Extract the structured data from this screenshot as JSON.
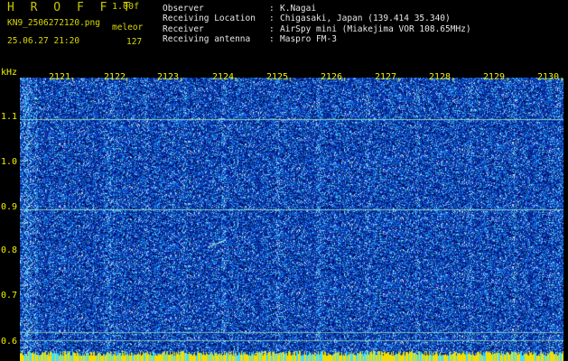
{
  "header": {
    "logo": "H R O F F T",
    "version": "1.00f",
    "filename": "KN9_2506272120.png",
    "program": "meleor",
    "datetime": "25.06.27 21:20",
    "count": "127",
    "fields": [
      {
        "label": "Observer",
        "value": "K.Nagai"
      },
      {
        "label": "Receiving Location",
        "value": "Chigasaki, Japan (139.414 35.340)"
      },
      {
        "label": "Receiver",
        "value": "AirSpy mini (Miakejima VOR 108.65MHz)"
      },
      {
        "label": "Receiving antenna",
        "value": "Maspro FM-3"
      }
    ]
  },
  "axes": {
    "y_unit": "kHz",
    "y_ticks": [
      "1.1",
      "1.0",
      "0.9",
      "0.8",
      "0.7",
      "0.6"
    ],
    "x_ticks": [
      "2121",
      "2122",
      "2123",
      "2124",
      "2125",
      "2126",
      "2127",
      "2128",
      "2129",
      "2130"
    ]
  },
  "colors": {
    "background": "#000000",
    "header_text": "#e6e6e6",
    "accent_yellow": "#d8d800",
    "waterfall_base": "#0a2a8c",
    "waterfall_noise": "#3fa0ff",
    "carrier_line": "#9fe7c8",
    "bottom_bar": "#f0e000"
  }
}
